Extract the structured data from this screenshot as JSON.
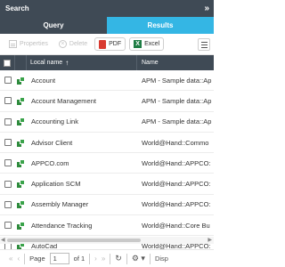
{
  "panel": {
    "title": "Search",
    "collapse_label": "»"
  },
  "tabs": [
    {
      "label": "Query"
    },
    {
      "label": "Results"
    }
  ],
  "toolbar": {
    "properties_label": "Properties",
    "delete_label": "Delete",
    "pdf_label": "PDF",
    "excel_label": "Excel",
    "excel_icon_letter": "X"
  },
  "grid": {
    "columns": {
      "local_name": "Local name",
      "name": "Name"
    },
    "sort_indicator": "↑",
    "rows": [
      {
        "local_name": "Account",
        "name": "APM - Sample data::Ap"
      },
      {
        "local_name": "Account Management",
        "name": "APM - Sample data::Ap"
      },
      {
        "local_name": "Accounting Link",
        "name": "APM - Sample data::Ap"
      },
      {
        "local_name": "Advisor Client",
        "name": "World@Hand::Commo"
      },
      {
        "local_name": "APPCO.com",
        "name": "World@Hand::APPCO:"
      },
      {
        "local_name": "Application SCM",
        "name": "World@Hand::APPCO:"
      },
      {
        "local_name": "Assembly Manager",
        "name": "World@Hand::APPCO:"
      },
      {
        "local_name": "Attendance Tracking",
        "name": "World@Hand::Core Bu"
      },
      {
        "local_name": "AutoCad",
        "name": "World@Hand::APPCO:"
      }
    ]
  },
  "pager": {
    "first": "«",
    "prev": "‹",
    "page_label": "Page",
    "page_value": "1",
    "of_label": "of 1",
    "next": "›",
    "last": "»",
    "refresh": "↻",
    "settings": "⚙ ▾",
    "display_label": "Disp"
  }
}
